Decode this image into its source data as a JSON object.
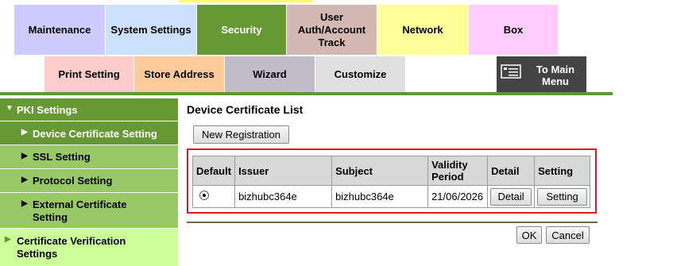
{
  "top_tabs": [
    {
      "label": "Maintenance",
      "color": "#ccccff"
    },
    {
      "label": "System Settings",
      "color": "#cce0ff"
    },
    {
      "label": "Security",
      "color": "#669933",
      "selected": true
    },
    {
      "label": "User\nAuth/Account\nTrack",
      "color": "#d4b8b4"
    },
    {
      "label": "Network",
      "color": "#ffff99"
    },
    {
      "label": "Box",
      "color": "#ffccff"
    }
  ],
  "sub_tabs": [
    {
      "label": "Print Setting",
      "color": "#ffcccc"
    },
    {
      "label": "Store Address",
      "color": "#ffcc99"
    },
    {
      "label": "Wizard",
      "color": "#c0bcc8"
    },
    {
      "label": "Customize",
      "color": "#e0e0e0"
    }
  ],
  "main_menu_button": {
    "label": "To Main\nMenu",
    "icon": "main-menu-icon",
    "color": "#444444"
  },
  "sidebar": {
    "section": "PKI Settings",
    "items": [
      {
        "label": "Device Certificate Setting",
        "selected": true
      },
      {
        "label": "SSL Setting"
      },
      {
        "label": "Protocol Setting"
      },
      {
        "label": "External Certificate\nSetting"
      }
    ],
    "other": "Certificate Verification\nSettings"
  },
  "page_title": "Device Certificate List",
  "new_registration_label": "New Registration",
  "table": {
    "headers": [
      "Default",
      "Issuer",
      "Subject",
      "Validity\nPeriod",
      "Detail",
      "Setting"
    ],
    "row": {
      "issuer": "bizhubc364e",
      "subject": "bizhubc364e",
      "validity": "21/06/2026",
      "detail_label": "Detail",
      "setting_label": "Setting"
    }
  },
  "ok_label": "OK",
  "cancel_label": "Cancel"
}
